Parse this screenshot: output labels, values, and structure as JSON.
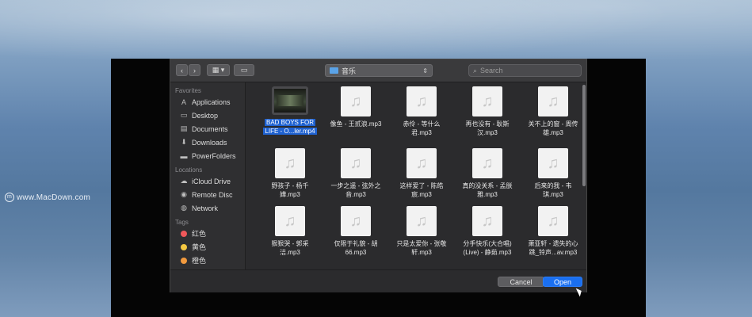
{
  "watermark": {
    "text": "www.MacDown.com"
  },
  "toolbar": {
    "back_label": "‹",
    "forward_label": "›",
    "view_label": "▦ ▾",
    "folder_label": "▭",
    "path_current": "音乐",
    "search_placeholder": "Search"
  },
  "sidebar": {
    "favorites_header": "Favorites",
    "favorites": [
      {
        "label": "Applications",
        "icon": "applications-icon"
      },
      {
        "label": "Desktop",
        "icon": "desktop-icon"
      },
      {
        "label": "Documents",
        "icon": "documents-icon"
      },
      {
        "label": "Downloads",
        "icon": "downloads-icon"
      },
      {
        "label": "PowerFolders",
        "icon": "folder-icon"
      }
    ],
    "locations_header": "Locations",
    "locations": [
      {
        "label": "iCloud Drive",
        "icon": "cloud-icon"
      },
      {
        "label": "Remote Disc",
        "icon": "disc-icon"
      },
      {
        "label": "Network",
        "icon": "globe-icon"
      }
    ],
    "tags_header": "Tags",
    "tags": [
      {
        "label": "红色",
        "color": "#f0585a"
      },
      {
        "label": "黄色",
        "color": "#f5c842"
      },
      {
        "label": "橙色",
        "color": "#f29a3e"
      }
    ]
  },
  "files": [
    {
      "line1": "BAD BOYS FOR",
      "line2": "LIFE - O...ler.mp4",
      "type": "video",
      "selected": true
    },
    {
      "line1": "像鱼 - 王贰浪.mp3",
      "line2": "",
      "type": "audio"
    },
    {
      "line1": "赤伶 - 等什么",
      "line2": "君.mp3",
      "type": "audio"
    },
    {
      "line1": "再也没有 - 耿斯",
      "line2": "汉.mp3",
      "type": "audio"
    },
    {
      "line1": "关不上的窗 - 周传",
      "line2": "雄.mp3",
      "type": "audio"
    },
    {
      "line1": "野孩子 - 杨千",
      "line2": "嬅.mp3",
      "type": "audio"
    },
    {
      "line1": "一步之遥 - 弦外之",
      "line2": "音.mp3",
      "type": "audio"
    },
    {
      "line1": "这样爱了 - 陈皓",
      "line2": "宸.mp3",
      "type": "audio"
    },
    {
      "line1": "真的没关系 - 孟朕",
      "line2": "雅.mp3",
      "type": "audio"
    },
    {
      "line1": "后来的我 - 韦",
      "line2": "琪.mp3",
      "type": "audio"
    },
    {
      "line1": "狠狠哭 - 郭采",
      "line2": "洁.mp3",
      "type": "audio"
    },
    {
      "line1": "仅限于礼貌 - 胡",
      "line2": "66.mp3",
      "type": "audio"
    },
    {
      "line1": "只是太爱你 - 张敬",
      "line2": "轩.mp3",
      "type": "audio"
    },
    {
      "line1": "分手快乐(大合唱)",
      "line2": "(Live) - 静茹.mp3",
      "type": "audio"
    },
    {
      "line1": "萧亚轩 - 遗失的心",
      "line2": "跳_铃声...av.mp3",
      "type": "audio"
    }
  ],
  "footer": {
    "cancel_label": "Cancel",
    "open_label": "Open"
  },
  "colors": {
    "accent": "#1a6ff0",
    "selection": "#1f62d1"
  }
}
